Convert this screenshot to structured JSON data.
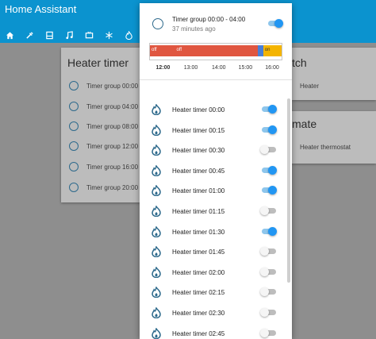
{
  "app": {
    "title": "Home Assistant"
  },
  "tabs": [
    {
      "icon": "home-icon"
    },
    {
      "icon": "tools-icon"
    },
    {
      "icon": "media-icon"
    },
    {
      "icon": "music-icon"
    },
    {
      "icon": "tv-icon"
    },
    {
      "icon": "snowflake-icon"
    },
    {
      "icon": "flame-icon"
    }
  ],
  "card_left": {
    "title": "Heater timer",
    "rows": [
      "Timer group 00:00",
      "Timer group 04:00",
      "Timer group 08:00",
      "Timer group 12:00",
      "Timer group 16:00",
      "Timer group 20:00"
    ]
  },
  "card_right_top": {
    "title_fragment": "tch",
    "row": "Heater"
  },
  "card_right_bottom": {
    "title_fragment": "mate",
    "row": "Heater thermostat"
  },
  "dialog": {
    "name": "Timer group 00:00 - 04:00",
    "time": "37 minutes ago",
    "state": "on",
    "timeline": {
      "segments": [
        {
          "label": "off",
          "start": 0.0,
          "end": 0.19,
          "color": "#e05640"
        },
        {
          "label": "off",
          "start": 0.19,
          "end": 0.82,
          "color": "#e05640"
        },
        {
          "label": "",
          "start": 0.82,
          "end": 0.86,
          "color": "#4a7fd6"
        },
        {
          "label": "on",
          "start": 0.86,
          "end": 1.0,
          "color": "#f4b400"
        }
      ],
      "ticks": [
        {
          "label": "12:00",
          "pos": 0.11,
          "bold": true
        },
        {
          "label": "13:00",
          "pos": 0.32
        },
        {
          "label": "14:00",
          "pos": 0.53
        },
        {
          "label": "15:00",
          "pos": 0.73
        },
        {
          "label": "16:00",
          "pos": 0.93
        }
      ]
    },
    "items": [
      {
        "name": "Heater timer 00:00",
        "on": true
      },
      {
        "name": "Heater timer 00:15",
        "on": true
      },
      {
        "name": "Heater timer 00:30",
        "on": false
      },
      {
        "name": "Heater timer 00:45",
        "on": true
      },
      {
        "name": "Heater timer 01:00",
        "on": true
      },
      {
        "name": "Heater timer 01:15",
        "on": false
      },
      {
        "name": "Heater timer 01:30",
        "on": true
      },
      {
        "name": "Heater timer 01:45",
        "on": false
      },
      {
        "name": "Heater timer 02:00",
        "on": false
      },
      {
        "name": "Heater timer 02:15",
        "on": false
      },
      {
        "name": "Heater timer 02:30",
        "on": false
      },
      {
        "name": "Heater timer 02:45",
        "on": false
      }
    ]
  },
  "colors": {
    "primary": "#0b93cf",
    "toggle_on": "#2196f3",
    "flame": "#2e6a8c"
  }
}
